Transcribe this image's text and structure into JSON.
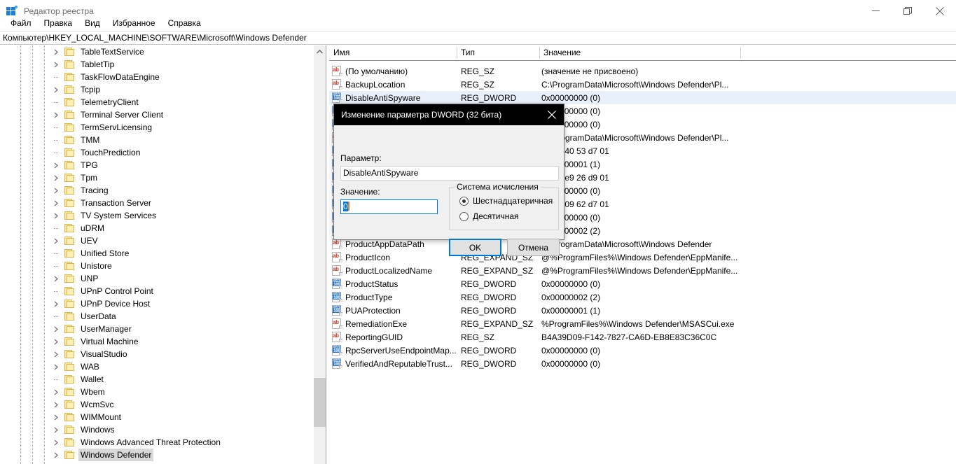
{
  "window": {
    "title": "Редактор реестра",
    "icon": "registry-editor-icon",
    "controls": {
      "minimize": "minimize-icon",
      "maximize": "maximize-icon",
      "close": "close-icon"
    }
  },
  "menu": {
    "items": [
      {
        "label": "Файл"
      },
      {
        "label": "Правка"
      },
      {
        "label": "Вид"
      },
      {
        "label": "Избранное"
      },
      {
        "label": "Справка"
      }
    ]
  },
  "address": {
    "path": "Компьютер\\HKEY_LOCAL_MACHINE\\SOFTWARE\\Microsoft\\Windows Defender"
  },
  "tree": {
    "scroll_arrow": "chevron-up-icon",
    "items": [
      {
        "label": "TableTextService",
        "expandable": true,
        "selected": false
      },
      {
        "label": "TabletTip",
        "expandable": true,
        "selected": false
      },
      {
        "label": "TaskFlowDataEngine",
        "expandable": false,
        "selected": false
      },
      {
        "label": "Tcpip",
        "expandable": true,
        "selected": false
      },
      {
        "label": "TelemetryClient",
        "expandable": false,
        "selected": false
      },
      {
        "label": "Terminal Server Client",
        "expandable": true,
        "selected": false
      },
      {
        "label": "TermServLicensing",
        "expandable": false,
        "selected": false
      },
      {
        "label": "TMM",
        "expandable": false,
        "selected": false
      },
      {
        "label": "TouchPrediction",
        "expandable": false,
        "selected": false
      },
      {
        "label": "TPG",
        "expandable": true,
        "selected": false
      },
      {
        "label": "Tpm",
        "expandable": true,
        "selected": false
      },
      {
        "label": "Tracing",
        "expandable": true,
        "selected": false
      },
      {
        "label": "Transaction Server",
        "expandable": true,
        "selected": false
      },
      {
        "label": "TV System Services",
        "expandable": true,
        "selected": false
      },
      {
        "label": "uDRM",
        "expandable": false,
        "selected": false
      },
      {
        "label": "UEV",
        "expandable": true,
        "selected": false
      },
      {
        "label": "Unified Store",
        "expandable": false,
        "selected": false
      },
      {
        "label": "Unistore",
        "expandable": false,
        "selected": false
      },
      {
        "label": "UNP",
        "expandable": true,
        "selected": false
      },
      {
        "label": "UPnP Control Point",
        "expandable": false,
        "selected": false
      },
      {
        "label": "UPnP Device Host",
        "expandable": true,
        "selected": false
      },
      {
        "label": "UserData",
        "expandable": false,
        "selected": false
      },
      {
        "label": "UserManager",
        "expandable": true,
        "selected": false
      },
      {
        "label": "Virtual Machine",
        "expandable": true,
        "selected": false
      },
      {
        "label": "VisualStudio",
        "expandable": true,
        "selected": false
      },
      {
        "label": "WAB",
        "expandable": true,
        "selected": false
      },
      {
        "label": "Wallet",
        "expandable": false,
        "selected": false
      },
      {
        "label": "Wbem",
        "expandable": true,
        "selected": false
      },
      {
        "label": "WcmSvc",
        "expandable": true,
        "selected": false
      },
      {
        "label": "WIMMount",
        "expandable": true,
        "selected": false
      },
      {
        "label": "Windows",
        "expandable": true,
        "selected": false
      },
      {
        "label": "Windows Advanced Threat Protection",
        "expandable": true,
        "selected": false
      },
      {
        "label": "Windows Defender",
        "expandable": true,
        "selected": true
      }
    ]
  },
  "value_list": {
    "columns": [
      {
        "label": "Имя"
      },
      {
        "label": "Тип"
      },
      {
        "label": "Значение"
      }
    ],
    "rows": [
      {
        "icon": "string-value-icon",
        "name": "(По умолчанию)",
        "type": "REG_SZ",
        "value": "(значение не присвоено)",
        "selected": false
      },
      {
        "icon": "string-value-icon",
        "name": "BackupLocation",
        "type": "REG_SZ",
        "value": "C:\\ProgramData\\Microsoft\\Windows Defender\\Pl...",
        "selected": false
      },
      {
        "icon": "dword-value-icon",
        "name": "DisableAntiSpyware",
        "type": "REG_DWORD",
        "value": "0x00000000 (0)",
        "selected": true
      },
      {
        "icon": "dword-value-icon",
        "name": "",
        "type": "",
        "value": "0x00000000 (0)",
        "selected": false
      },
      {
        "icon": "dword-value-icon",
        "name": "",
        "type": "",
        "value": "0x00000000 (0)",
        "selected": false
      },
      {
        "icon": "string-value-icon",
        "name": "",
        "type": "",
        "value": "C:\\ProgramData\\Microsoft\\Windows Defender\\Pl...",
        "selected": false
      },
      {
        "icon": "binary-value-icon",
        "name": "",
        "type": "",
        "value": "8a dd 40 53 d7 01",
        "selected": false
      },
      {
        "icon": "dword-value-icon",
        "name": "",
        "type": "",
        "value": "0x00000001 (1)",
        "selected": false
      },
      {
        "icon": "binary-value-icon",
        "name": "",
        "type": "",
        "value": "15 eb e9 26 d9 01",
        "selected": false
      },
      {
        "icon": "dword-value-icon",
        "name": "",
        "type": "",
        "value": "0x00000000 (0)",
        "selected": false
      },
      {
        "icon": "binary-value-icon",
        "name": "",
        "type": "",
        "value": "a6 30 09 62 d7 01",
        "selected": false
      },
      {
        "icon": "dword-value-icon",
        "name": "",
        "type": "",
        "value": "0x00000000 (0)",
        "selected": false
      },
      {
        "icon": "dword-value-icon",
        "name": "",
        "type": "",
        "value": "0x00000002 (2)",
        "selected": false
      },
      {
        "icon": "string-value-icon",
        "name": "ProductAppDataPath",
        "type": "REG_SZ",
        "value": "C:\\ProgramData\\Microsoft\\Windows Defender",
        "selected": false
      },
      {
        "icon": "string-value-icon",
        "name": "ProductIcon",
        "type": "REG_EXPAND_SZ",
        "value": "@%ProgramFiles%\\Windows Defender\\EppManife...",
        "selected": false
      },
      {
        "icon": "string-value-icon",
        "name": "ProductLocalizedName",
        "type": "REG_EXPAND_SZ",
        "value": "@%ProgramFiles%\\Windows Defender\\EppManife...",
        "selected": false
      },
      {
        "icon": "dword-value-icon",
        "name": "ProductStatus",
        "type": "REG_DWORD",
        "value": "0x00000000 (0)",
        "selected": false
      },
      {
        "icon": "dword-value-icon",
        "name": "ProductType",
        "type": "REG_DWORD",
        "value": "0x00000002 (2)",
        "selected": false
      },
      {
        "icon": "dword-value-icon",
        "name": "PUAProtection",
        "type": "REG_DWORD",
        "value": "0x00000001 (1)",
        "selected": false
      },
      {
        "icon": "string-value-icon",
        "name": "RemediationExe",
        "type": "REG_EXPAND_SZ",
        "value": "%ProgramFiles%\\Windows Defender\\MSASCui.exe",
        "selected": false
      },
      {
        "icon": "string-value-icon",
        "name": "ReportingGUID",
        "type": "REG_SZ",
        "value": "B4A39D09-F142-7827-CA6D-EB8E83C36C0C",
        "selected": false
      },
      {
        "icon": "dword-value-icon",
        "name": "RpcServerUseEndpointMap...",
        "type": "REG_DWORD",
        "value": "0x00000000 (0)",
        "selected": false
      },
      {
        "icon": "dword-value-icon",
        "name": "VerifiedAndReputableTrust...",
        "type": "REG_DWORD",
        "value": "0x00000000 (0)",
        "selected": false
      }
    ]
  },
  "dialog": {
    "title": "Изменение параметра DWORD (32 бита)",
    "close_icon": "close-icon",
    "name_label": "Параметр:",
    "name_value": "DisableAntiSpyware",
    "value_label": "Значение:",
    "value_value": "0",
    "base_group_label": "Система исчисления",
    "radio_hex": "Шестнадцатеричная",
    "radio_dec": "Десятичная",
    "radio_selected": "hex",
    "ok_label": "OK",
    "cancel_label": "Отмена"
  },
  "colors": {
    "accent": "#0078d7",
    "selection": "#e8f0fb",
    "tree_selection": "#d8d8d8",
    "dialog_titlebar": "#000000",
    "folder": "#fdefb8"
  }
}
